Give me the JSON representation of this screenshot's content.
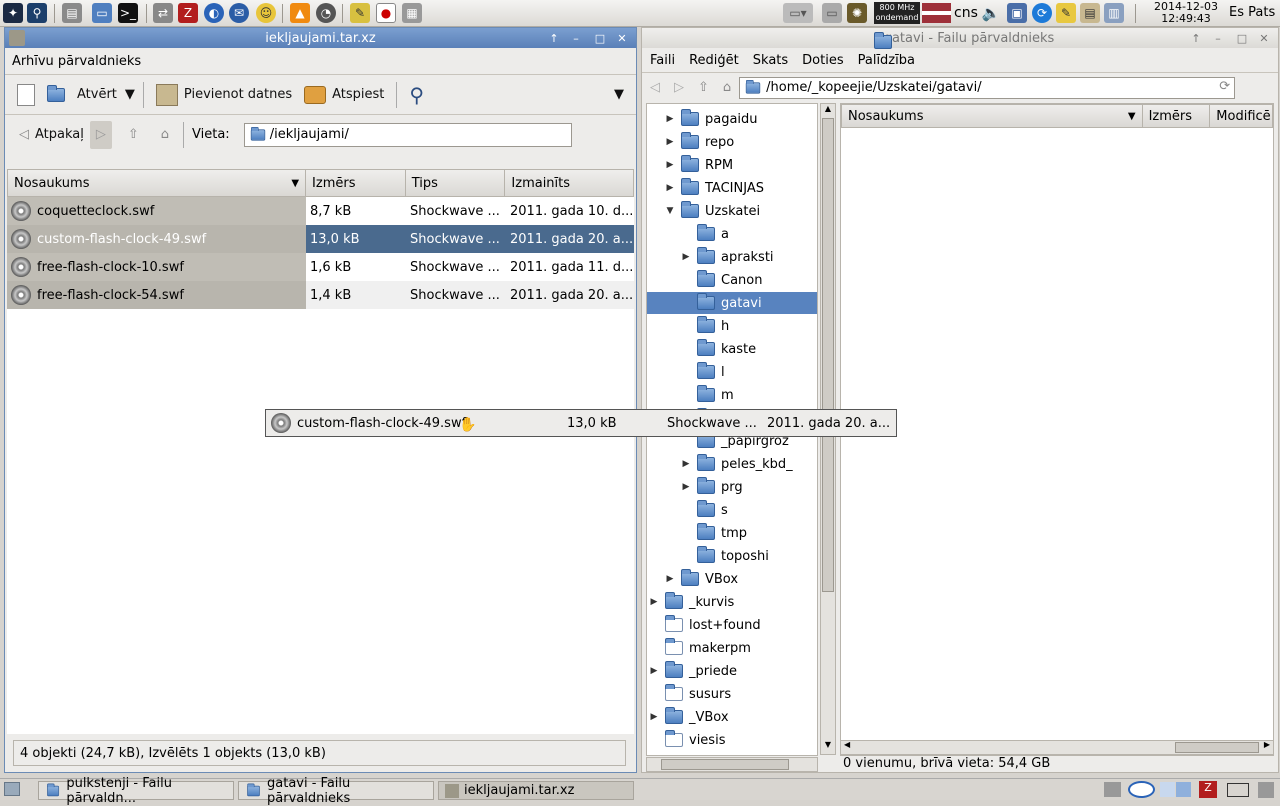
{
  "top_panel": {
    "cpu_line1": "800 MHz",
    "cpu_line2": "ondemand",
    "keyboard": "cns",
    "date": "2014-12-03",
    "time": "12:49:43",
    "user": "Es Pats"
  },
  "left_window": {
    "title": "iekljaujami.tar.xz",
    "app_name": "Arhīvu pārvaldnieks",
    "toolbar": {
      "open": "Atvērt",
      "add_files": "Pievienot datnes",
      "extract": "Atspiest"
    },
    "nav": {
      "back": "Atpakaļ",
      "location_label": "Vieta:",
      "location_value": "/iekljaujami/"
    },
    "columns": [
      "Nosaukums",
      "Izmērs",
      "Tips",
      "Izmainīts"
    ],
    "files": [
      {
        "name": "coquetteclock.swf",
        "size": "8,7 kB",
        "type": "Shockwave ...",
        "modified": "2011. gada 10. d..."
      },
      {
        "name": "custom-flash-clock-49.swf",
        "size": "13,0 kB",
        "type": "Shockwave ...",
        "modified": "2011. gada 20. a..."
      },
      {
        "name": "free-flash-clock-10.swf",
        "size": "1,6 kB",
        "type": "Shockwave ...",
        "modified": "2011. gada 11. d..."
      },
      {
        "name": "free-flash-clock-54.swf",
        "size": "1,4 kB",
        "type": "Shockwave ...",
        "modified": "2011. gada 20. a..."
      }
    ],
    "status": "4 objekti (24,7 kB), Izvēlēts 1 objekts (13,0 kB)"
  },
  "drag": {
    "name": "custom-flash-clock-49.swf",
    "size": "13,0 kB",
    "type": "Shockwave ...",
    "modified": "2011. gada 20. a..."
  },
  "right_window": {
    "title": "gatavi - Failu pārvaldnieks",
    "menu": [
      "Faili",
      "Rediģēt",
      "Skats",
      "Doties",
      "Palīdzība"
    ],
    "path": "/home/_kopeejie/Uzskatei/gatavi/",
    "columns": [
      "Nosaukums",
      "Izmērs",
      "Modificē"
    ],
    "tree": [
      {
        "label": "pagaidu",
        "expander": "▶"
      },
      {
        "label": "repo",
        "expander": "▶"
      },
      {
        "label": "RPM",
        "expander": "▶"
      },
      {
        "label": "TACINJAS",
        "expander": "▶"
      },
      {
        "label": "Uzskatei",
        "expander": "▼"
      },
      {
        "label": "a",
        "expander": ""
      },
      {
        "label": "apraksti",
        "expander": "▶"
      },
      {
        "label": "Canon",
        "expander": ""
      },
      {
        "label": "gatavi",
        "expander": ""
      },
      {
        "label": "h",
        "expander": ""
      },
      {
        "label": "kaste",
        "expander": ""
      },
      {
        "label": "l",
        "expander": ""
      },
      {
        "label": "m",
        "expander": ""
      },
      {
        "label": "",
        "expander": ""
      },
      {
        "label": "_papirgroz",
        "expander": ""
      },
      {
        "label": "peles_kbd_",
        "expander": "▶"
      },
      {
        "label": "prg",
        "expander": "▶"
      },
      {
        "label": "s",
        "expander": ""
      },
      {
        "label": "tmp",
        "expander": ""
      },
      {
        "label": "toposhi",
        "expander": ""
      },
      {
        "label": "VBox",
        "expander": "▶"
      },
      {
        "label": "_kurvis",
        "expander": "▶"
      },
      {
        "label": "lost+found",
        "expander": ""
      },
      {
        "label": "makerpm",
        "expander": ""
      },
      {
        "label": "_priede",
        "expander": "▶"
      },
      {
        "label": "susurs",
        "expander": ""
      },
      {
        "label": "_VBox",
        "expander": "▶"
      },
      {
        "label": "viesis",
        "expander": ""
      }
    ],
    "status": "0 vienumu, brīvā vieta: 54,4 GB"
  },
  "taskbar": [
    "pulkstenji - Failu pārvaldn...",
    "gatavi - Failu pārvaldnieks",
    "iekljaujami.tar.xz"
  ]
}
